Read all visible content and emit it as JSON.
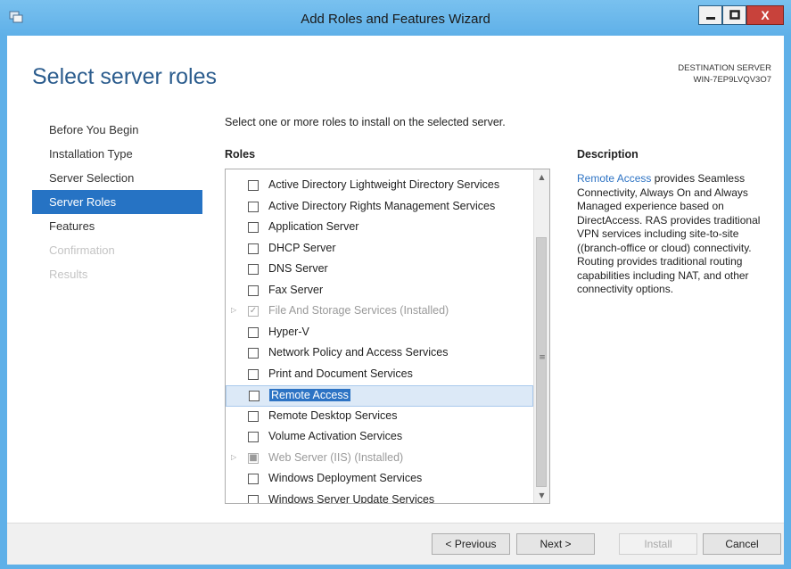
{
  "window": {
    "title": "Add Roles and Features Wizard",
    "close_glyph": "X"
  },
  "page": {
    "title": "Select server roles",
    "destination_label": "DESTINATION SERVER",
    "destination_value": "WIN-7EP9LVQV3O7"
  },
  "nav": {
    "items": [
      {
        "label": "Before You Begin",
        "state": "normal"
      },
      {
        "label": "Installation Type",
        "state": "normal"
      },
      {
        "label": "Server Selection",
        "state": "normal"
      },
      {
        "label": "Server Roles",
        "state": "active"
      },
      {
        "label": "Features",
        "state": "normal"
      },
      {
        "label": "Confirmation",
        "state": "disabled"
      },
      {
        "label": "Results",
        "state": "disabled"
      }
    ]
  },
  "main": {
    "intro": "Select one or more roles to install on the selected server.",
    "roles_label": "Roles",
    "roles": [
      {
        "label": "Active Directory Lightweight Directory Services"
      },
      {
        "label": "Active Directory Rights Management Services"
      },
      {
        "label": "Application Server"
      },
      {
        "label": "DHCP Server"
      },
      {
        "label": "DNS Server"
      },
      {
        "label": "Fax Server"
      },
      {
        "label": "File And Storage Services (Installed)"
      },
      {
        "label": "Hyper-V"
      },
      {
        "label": "Network Policy and Access Services"
      },
      {
        "label": "Print and Document Services"
      },
      {
        "label": "Remote Access"
      },
      {
        "label": "Remote Desktop Services"
      },
      {
        "label": "Volume Activation Services"
      },
      {
        "label": "Web Server (IIS) (Installed)"
      },
      {
        "label": "Windows Deployment Services"
      },
      {
        "label": "Windows Server Update Services"
      }
    ]
  },
  "description": {
    "heading": "Description",
    "link": "Remote Access",
    "text": " provides Seamless Connectivity, Always On and Always Managed experience based on DirectAccess. RAS provides traditional VPN services including site-to-site ((branch-office or cloud) connectivity. Routing provides traditional routing capabilities including NAT, and other connectivity options."
  },
  "footer": {
    "previous": "< Previous",
    "next": "Next >",
    "install": "Install",
    "cancel": "Cancel"
  },
  "colors": {
    "window_frame": "#5fb0e8",
    "accent_blue": "#2673c4",
    "title_text": "#2c5d8e",
    "close_button": "#c8423b"
  }
}
